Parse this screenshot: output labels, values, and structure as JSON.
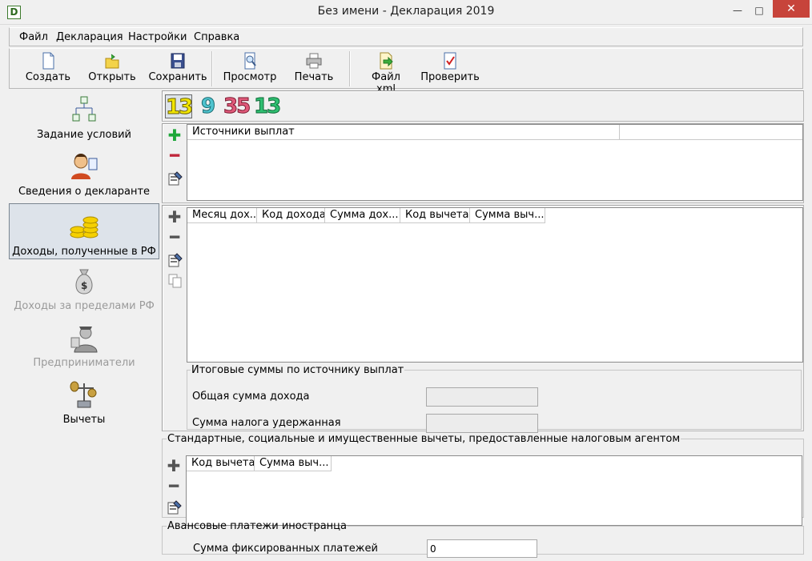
{
  "window": {
    "title": "Без имени - Декларация 2019",
    "app_icon_letter": "D",
    "minimize": "—",
    "maximize": "□",
    "close": "✕"
  },
  "menu": [
    {
      "label": "Файл"
    },
    {
      "label": "Декларация"
    },
    {
      "label": "Настройки"
    },
    {
      "label": "Справка"
    }
  ],
  "toolbar": {
    "create": "Создать",
    "open": "Открыть",
    "save": "Сохранить",
    "preview": "Просмотр",
    "print": "Печать",
    "xml": "Файл xml",
    "check": "Проверить"
  },
  "sidebar": [
    {
      "label": "Задание условий",
      "icon": "flowchart-icon",
      "state": "normal"
    },
    {
      "label": "Сведения о декларанте",
      "icon": "person-icon",
      "state": "normal"
    },
    {
      "label": "Доходы, полученные в РФ",
      "icon": "coins-icon",
      "state": "active"
    },
    {
      "label": "Доходы за пределами РФ",
      "icon": "money-bag-icon",
      "state": "disabled"
    },
    {
      "label": "Предприниматели",
      "icon": "businessman-icon",
      "state": "disabled"
    },
    {
      "label": "Вычеты",
      "icon": "scales-icon",
      "state": "normal"
    }
  ],
  "rate_tabs": [
    {
      "label": "13",
      "color": "#f2e600"
    },
    {
      "label": "9",
      "color": "#4fc4cf"
    },
    {
      "label": "35",
      "color": "#e05a7a"
    },
    {
      "label": "13",
      "color": "#2fbf71"
    }
  ],
  "sources": {
    "header": "Источники выплат"
  },
  "income": {
    "columns": [
      "Месяц дох...",
      "Код дохода",
      "Сумма дох...",
      "Код вычета",
      "Сумма выч..."
    ]
  },
  "totals": {
    "legend": "Итоговые суммы по источнику выплат",
    "total_income_label": "Общая сумма дохода",
    "tax_withheld_label": "Сумма налога удержанная"
  },
  "deductions": {
    "legend": "Стандартные, социальные и имущественные вычеты, предоставленные налоговым агентом",
    "columns": [
      "Код вычета",
      "Сумма выч..."
    ]
  },
  "advance": {
    "legend": "Авансовые платежи иностранца",
    "fixed_label": "Сумма фиксированных платежей",
    "fixed_value": "0"
  },
  "colors": {
    "add": "#1ea83a",
    "remove": "#c0263a",
    "active_bg": "#dde3ea"
  }
}
